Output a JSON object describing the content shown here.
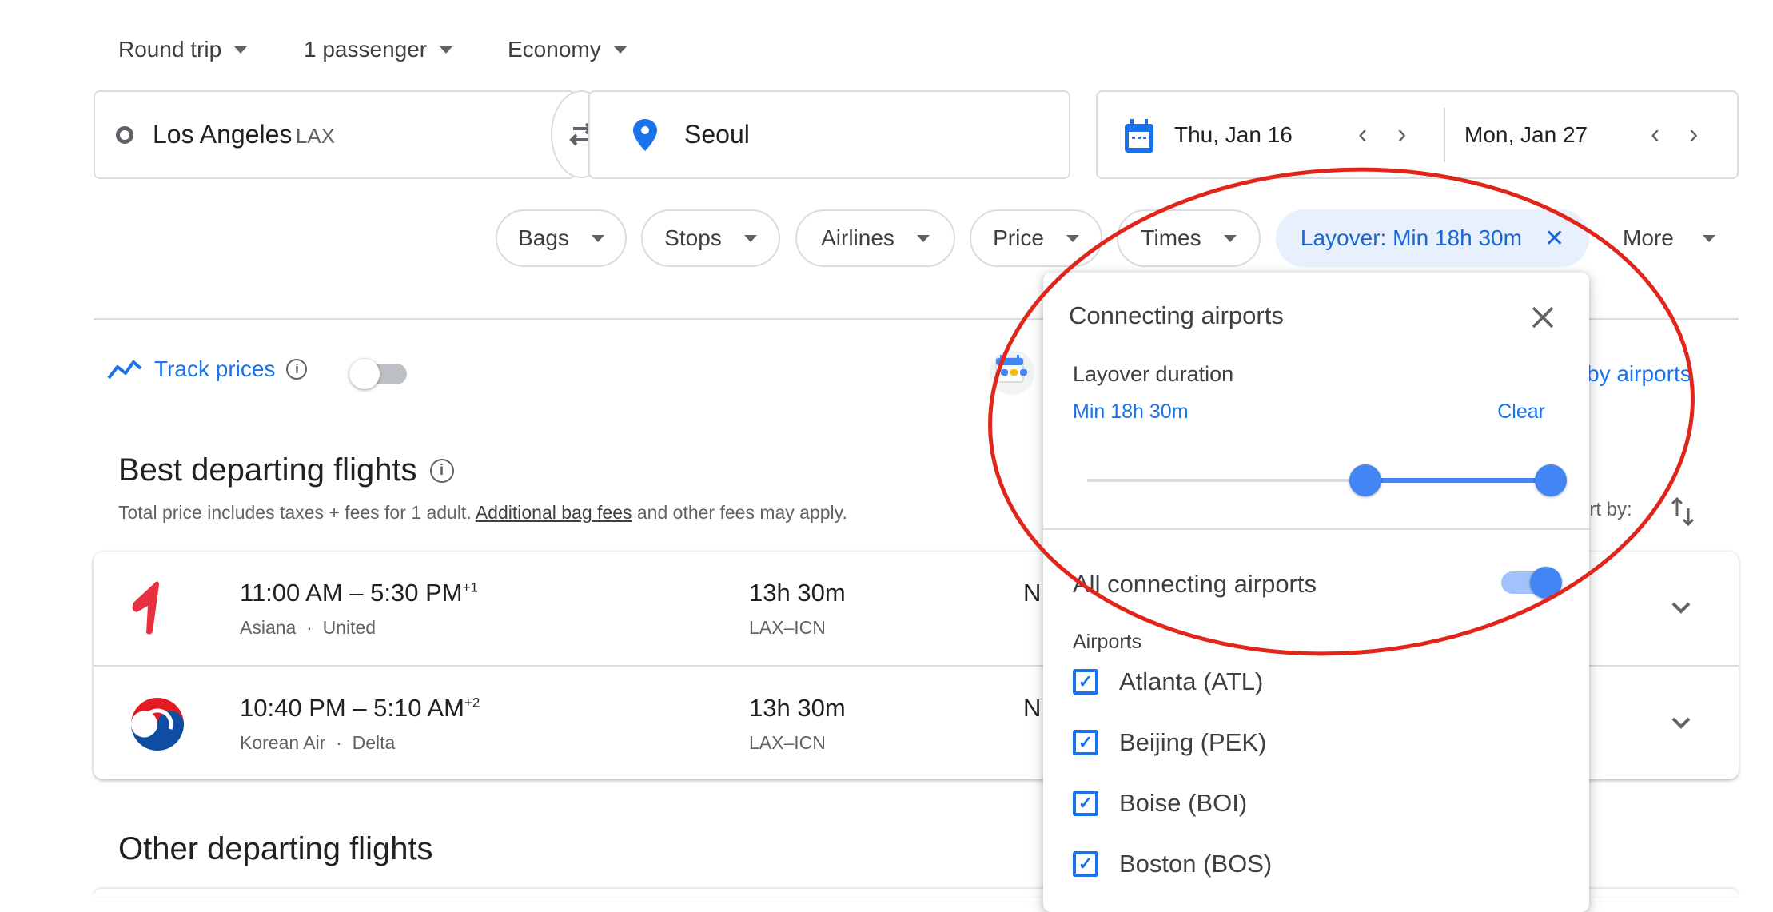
{
  "trip_options": {
    "trip_type": "Round trip",
    "passengers": "1 passenger",
    "cabin_class": "Economy"
  },
  "search": {
    "origin_city": "Los Angeles",
    "origin_code": "LAX",
    "destination": "Seoul",
    "depart_date": "Thu, Jan 16",
    "return_date": "Mon, Jan 27"
  },
  "filters": {
    "chips": [
      {
        "label": "Bags"
      },
      {
        "label": "Stops"
      },
      {
        "label": "Airlines"
      },
      {
        "label": "Price"
      },
      {
        "label": "Times"
      }
    ],
    "active_chip": "Layover: Min 18h 30m",
    "more_label": "More"
  },
  "track": {
    "label": "Track prices",
    "enabled": false
  },
  "partial_right": {
    "by_airports": "by airports",
    "sort_by": "ort by:"
  },
  "best": {
    "title": "Best departing flights",
    "subtitle_pre": "Total price includes taxes + fees for 1 adult. ",
    "subtitle_link": "Additional bag fees",
    "subtitle_post": " and other fees may apply.",
    "flights": [
      {
        "depart": "11:00 AM",
        "arrive": "5:30 PM",
        "day_offset": "+1",
        "airlines": [
          "Asiana",
          "United"
        ],
        "duration": "13h 30m",
        "route": "LAX–ICN",
        "stops_partial": "N"
      },
      {
        "depart": "10:40 PM",
        "arrive": "5:10 AM",
        "day_offset": "+2",
        "airlines": [
          "Korean Air",
          "Delta"
        ],
        "duration": "13h 30m",
        "route": "LAX–ICN",
        "stops_partial": "N"
      }
    ]
  },
  "other": {
    "title": "Other departing flights"
  },
  "popup": {
    "title": "Connecting airports",
    "layover_label": "Layover duration",
    "layover_value": "Min 18h 30m",
    "clear_label": "Clear",
    "slider": {
      "min_fraction": 0.6,
      "max_fraction": 1.0
    },
    "all_airports_label": "All connecting airports",
    "all_airports_enabled": true,
    "airports_heading": "Airports",
    "airports": [
      {
        "label": "Atlanta (ATL)",
        "checked": true
      },
      {
        "label": "Beijing (PEK)",
        "checked": true
      },
      {
        "label": "Boise (BOI)",
        "checked": true
      },
      {
        "label": "Boston (BOS)",
        "checked": true
      }
    ]
  },
  "colors": {
    "accent": "#1a73e8",
    "accent_light": "#e8f0fe",
    "slider": "#4285f4",
    "annotation": "#e0261b",
    "text": "#202124",
    "muted": "#5f6368",
    "border": "#dadce0"
  }
}
